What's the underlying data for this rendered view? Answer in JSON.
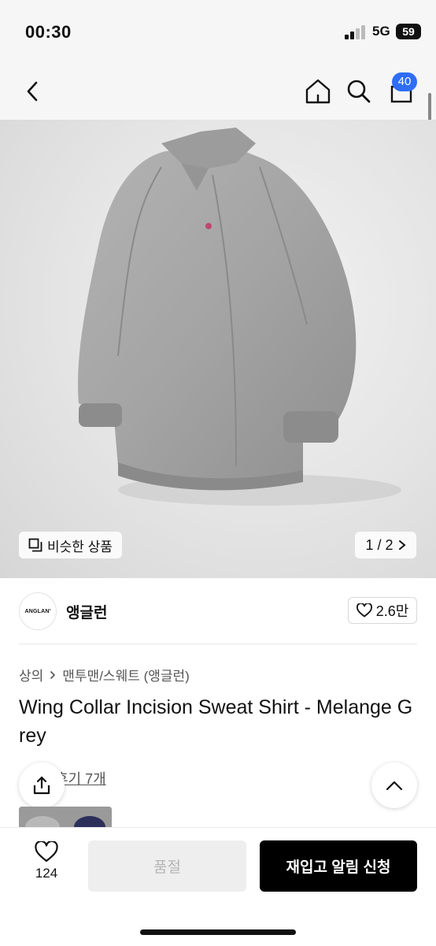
{
  "status": {
    "time": "00:30",
    "network": "5G",
    "battery": "59"
  },
  "nav": {
    "cart_count": "40"
  },
  "gallery": {
    "similar_label": "비슷한 상품",
    "pager": "1 / 2"
  },
  "brand": {
    "logo_text": "ANGLAN'",
    "name": "앵글런",
    "likes": "2.6만"
  },
  "breadcrumb": {
    "category": "상의",
    "subcategory": "맨투맨/스웨트 (앵글런)"
  },
  "product": {
    "title": "Wing Collar Incision Sweat Shirt - Melange Grey"
  },
  "reviews": {
    "link_text": "후기 7개"
  },
  "bottom": {
    "wish_count": "124",
    "soldout_label": "품절",
    "restock_label": "재입고 알림 신청"
  },
  "colors": {
    "accent": "#2f6df6",
    "primary_button": "#000000",
    "disabled_button": "#eeeeee"
  }
}
